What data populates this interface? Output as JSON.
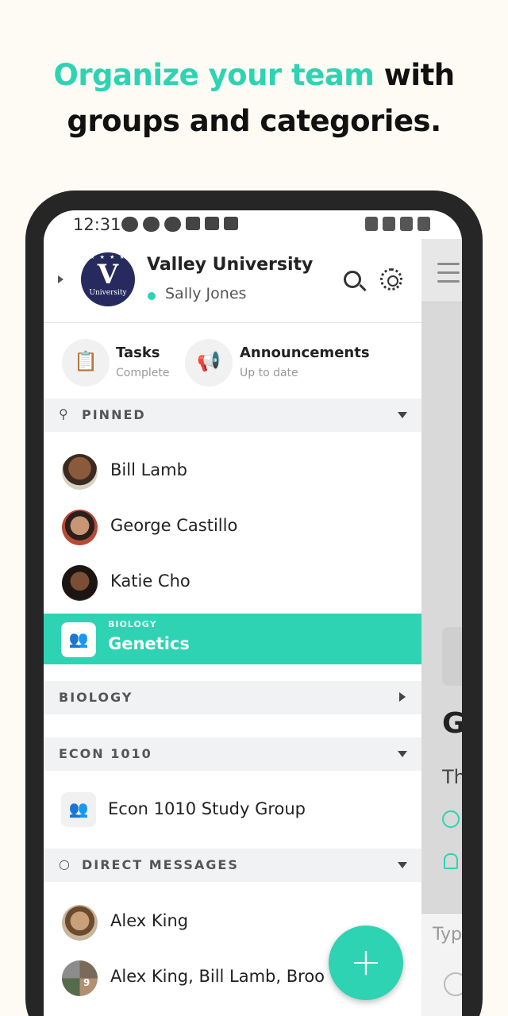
{
  "headline": {
    "accent": "Organize your team",
    "line1_rest": " with",
    "line2": "groups and categories."
  },
  "statusbar": {
    "time": "12:31"
  },
  "org": {
    "name": "Valley University",
    "logo_letter": "V",
    "logo_text": "University",
    "user": "Sally Jones",
    "status_color": "#2ed3b3"
  },
  "quick": {
    "tasks": {
      "title": "Tasks",
      "subtitle": "Complete",
      "icon": "clipboard-icon"
    },
    "announcements": {
      "title": "Announcements",
      "subtitle": "Up to date",
      "icon": "megaphone-icon"
    }
  },
  "sections": {
    "pinned": "PINNED",
    "biology": "BIOLOGY",
    "econ": "ECON 1010",
    "dm": "DIRECT MESSAGES"
  },
  "pinned_items": [
    {
      "name": "Bill Lamb"
    },
    {
      "name": "George Castillo"
    },
    {
      "name": "Katie Cho"
    }
  ],
  "active_group": {
    "category": "BIOLOGY",
    "name": "Genetics"
  },
  "econ_items": [
    {
      "name": "Econ 1010 Study Group"
    }
  ],
  "dm_items": [
    {
      "name": "Alex King"
    },
    {
      "name": "Alex King, Bill Lamb, Broo"
    }
  ],
  "dm_group_count": "9",
  "background_peek": {
    "title_initial": "G",
    "subtitle_start": "Th",
    "input_placeholder": "Typ"
  },
  "colors": {
    "accent": "#2ed3b3",
    "background": "#fdfbf3"
  },
  "fab": {
    "label": "+"
  }
}
